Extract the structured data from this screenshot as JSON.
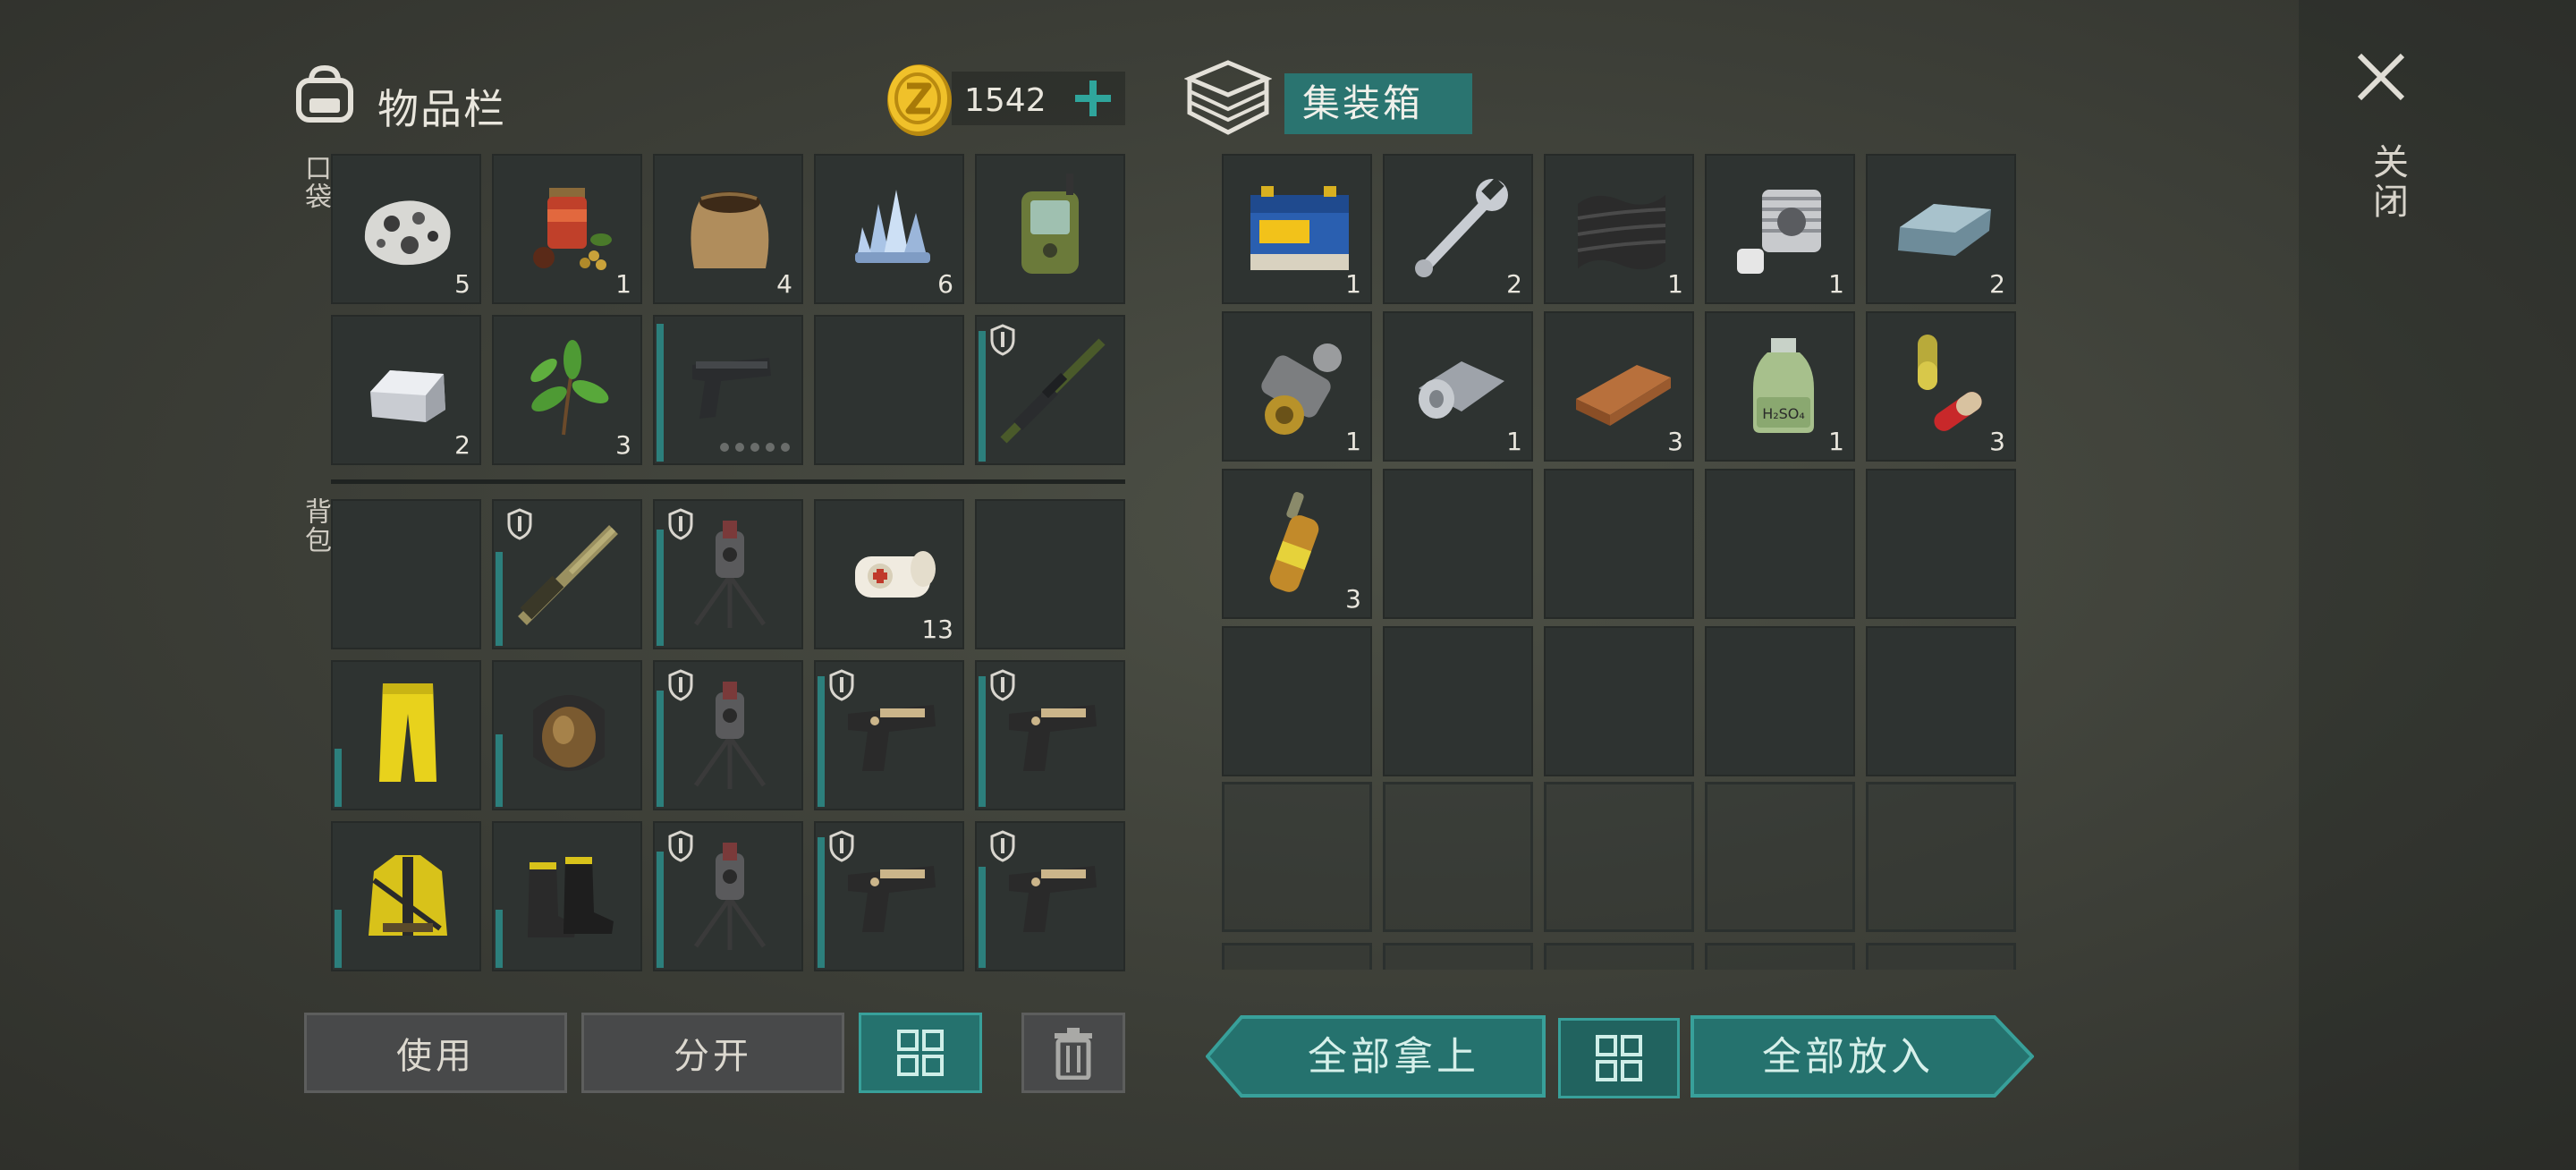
{
  "inventory": {
    "title": "物品栏",
    "coins": "1542",
    "pocket_label": "口袋",
    "backpack_label": "背包",
    "pocket": [
      {
        "icon": "stone-icon",
        "count": "5"
      },
      {
        "icon": "spices-icon",
        "count": "1"
      },
      {
        "icon": "soil-sack-icon",
        "count": "4"
      },
      {
        "icon": "crystal-icon",
        "count": "6"
      },
      {
        "icon": "gps-device-icon",
        "count": ""
      },
      {
        "icon": "metal-ingot-icon",
        "count": "2"
      },
      {
        "icon": "herb-leaves-icon",
        "count": "3"
      },
      {
        "icon": "pistol-icon",
        "count": "",
        "dur": 0.95,
        "ammo": true
      },
      {
        "icon": "",
        "count": ""
      },
      {
        "icon": "sniper-rifle-icon",
        "count": "",
        "dur": 0.9,
        "shield": true
      }
    ],
    "backpack": [
      {
        "icon": "",
        "count": ""
      },
      {
        "icon": "shotgun-icon",
        "count": "",
        "dur": 0.65,
        "shield": true
      },
      {
        "icon": "turret-icon",
        "count": "",
        "dur": 0.8,
        "shield": true
      },
      {
        "icon": "bandage-icon",
        "count": "13"
      },
      {
        "icon": "",
        "count": ""
      },
      {
        "icon": "yellow-pants-icon",
        "count": "",
        "dur": 0.4
      },
      {
        "icon": "gas-mask-icon",
        "count": "",
        "dur": 0.5
      },
      {
        "icon": "turret-icon",
        "count": "",
        "dur": 0.8,
        "shield": true
      },
      {
        "icon": "desert-eagle-icon",
        "count": "",
        "dur": 0.9,
        "shield": true
      },
      {
        "icon": "desert-eagle-icon",
        "count": "",
        "dur": 0.9,
        "shield": true
      },
      {
        "icon": "yellow-jacket-icon",
        "count": "",
        "dur": 0.4
      },
      {
        "icon": "combat-boots-icon",
        "count": "",
        "dur": 0.4
      },
      {
        "icon": "turret-icon",
        "count": "",
        "dur": 0.8,
        "shield": true
      },
      {
        "icon": "desert-eagle-icon",
        "count": "",
        "dur": 0.9,
        "shield": true
      },
      {
        "icon": "desert-eagle-icon",
        "count": "",
        "dur": 0.7,
        "shield": true
      }
    ],
    "buttons": {
      "use": "使用",
      "split": "分开"
    }
  },
  "container": {
    "title": "集装箱",
    "slots": [
      {
        "icon": "battery-icon",
        "count": "1"
      },
      {
        "icon": "wrench-icon",
        "count": "2"
      },
      {
        "icon": "carbon-fiber-icon",
        "count": "1"
      },
      {
        "icon": "engine-cylinder-icon",
        "count": "1"
      },
      {
        "icon": "steel-bar-icon",
        "count": "2"
      },
      {
        "icon": "gear-spring-icon",
        "count": "1"
      },
      {
        "icon": "metal-roll-icon",
        "count": "1"
      },
      {
        "icon": "wood-plank-icon",
        "count": "3"
      },
      {
        "icon": "chemical-bottle-icon",
        "count": "1",
        "text": "H₂SO₄"
      },
      {
        "icon": "capsule-icon",
        "count": "3"
      },
      {
        "icon": "ampoule-icon",
        "count": "3"
      },
      {
        "icon": "",
        "count": ""
      },
      {
        "icon": "",
        "count": ""
      },
      {
        "icon": "",
        "count": ""
      },
      {
        "icon": "",
        "count": ""
      },
      {
        "icon": "",
        "count": ""
      },
      {
        "icon": "",
        "count": ""
      },
      {
        "icon": "",
        "count": ""
      },
      {
        "icon": "",
        "count": ""
      },
      {
        "icon": "",
        "count": ""
      }
    ],
    "buttons": {
      "take_all": "全部拿上",
      "put_all": "全部放入"
    }
  },
  "close_label": "关闭",
  "colors": {
    "accent": "#2a7470",
    "slot": "#2e3331",
    "durability": "#2c7f7c"
  }
}
